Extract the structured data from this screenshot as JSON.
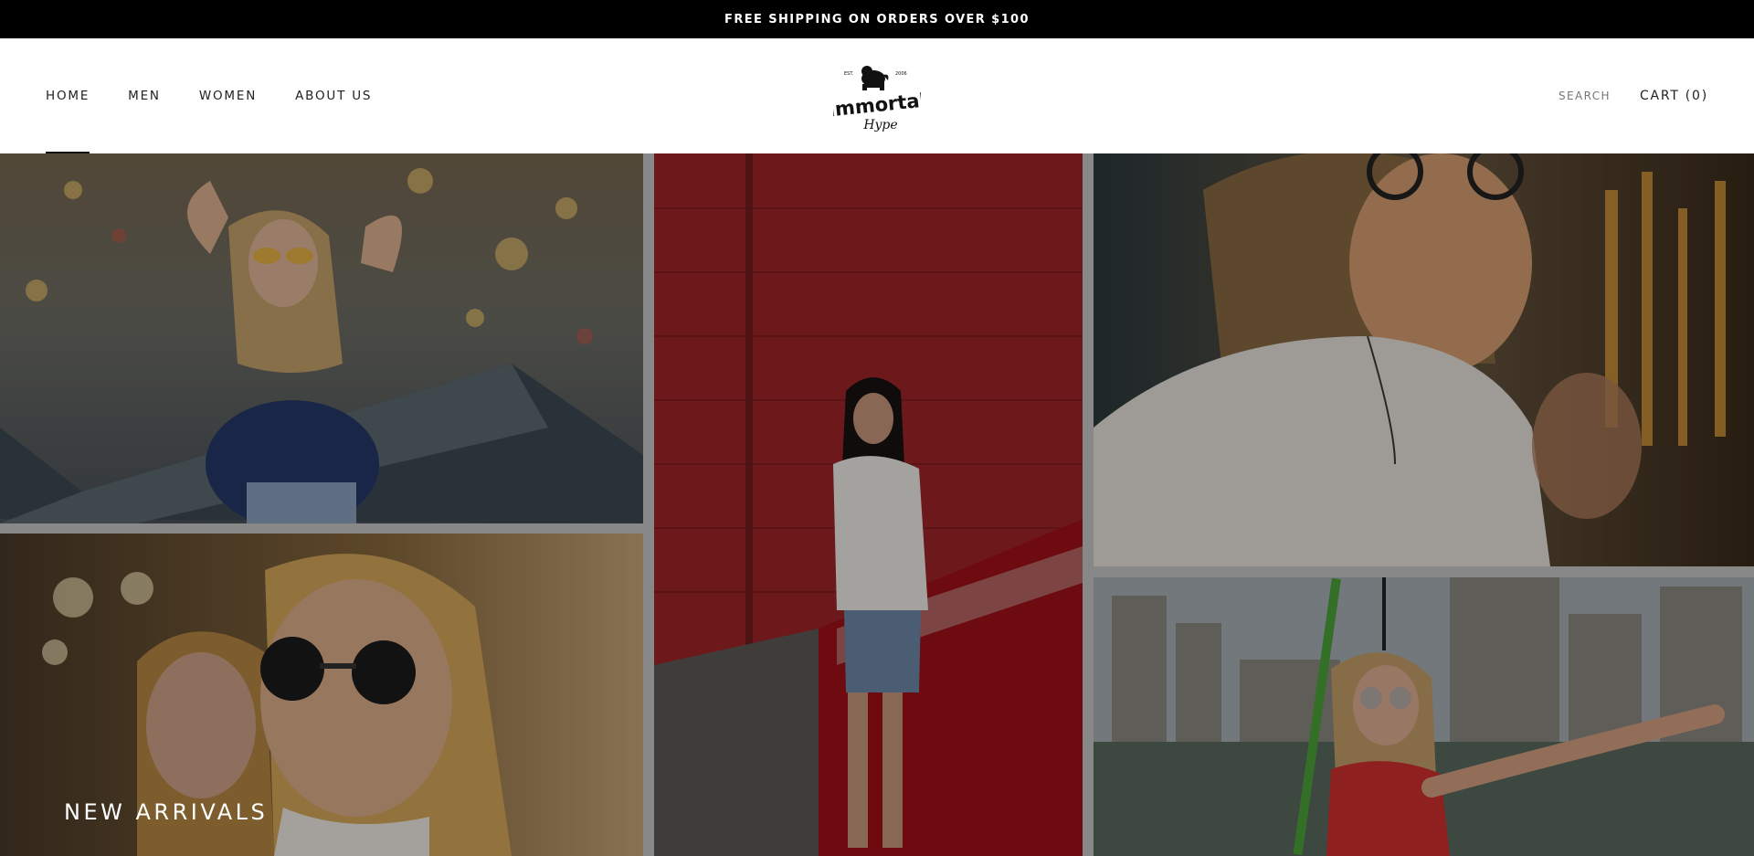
{
  "announcement": {
    "text": "FREE SHIPPING ON ORDERS OVER $100"
  },
  "nav": {
    "items": [
      {
        "label": "HOME",
        "active": true
      },
      {
        "label": "MEN",
        "active": false
      },
      {
        "label": "WOMEN",
        "active": false
      },
      {
        "label": "ABOUT US",
        "active": false
      }
    ]
  },
  "logo": {
    "est": "EST.",
    "year": "2006",
    "wordmark": "Immortal",
    "script": "Hype",
    "icon": "bulldog-icon"
  },
  "header_right": {
    "search_label": "SEARCH",
    "cart_label": "CART",
    "cart_count": "(0)"
  },
  "hero": {
    "title": "NEW ARRIVALS",
    "tiles": [
      "photo-woman-yellow-sunglasses-carnival",
      "photo-man-round-sunglasses-with-woman",
      "photo-woman-red-brick-wall",
      "photo-man-necklace-sunset",
      "photo-woman-pointing-city"
    ]
  },
  "colors": {
    "announcement_bg": "#000000",
    "text": "#222222",
    "search_text": "#777777"
  }
}
